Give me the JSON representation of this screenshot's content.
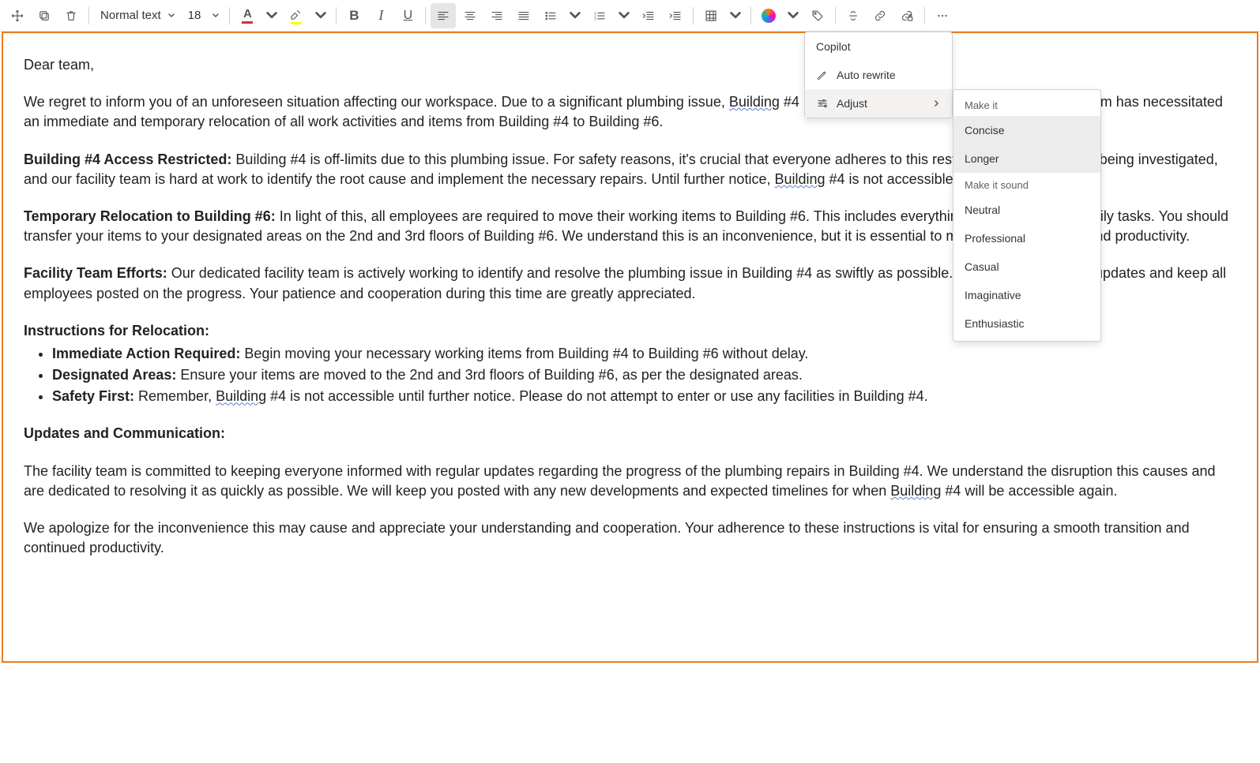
{
  "toolbar": {
    "style_label": "Normal text",
    "font_size": "18"
  },
  "copilot_menu": {
    "copilot": "Copilot",
    "auto_rewrite": "Auto rewrite",
    "adjust": "Adjust"
  },
  "adjust_menu": {
    "header1": "Make it",
    "concise": "Concise",
    "longer": "Longer",
    "header2": "Make it sound",
    "neutral": "Neutral",
    "professional": "Professional",
    "casual": "Casual",
    "imaginative": "Imaginative",
    "enthusiastic": "Enthusiastic"
  },
  "doc": {
    "greeting": "Dear team,",
    "p1a": "We regret to inform you of an unforeseen situation affecting our workspace. Due to a significant plumbing issue, ",
    "p1_link1": "Building",
    "p1b": " #4 is no longer accessible. This unforeseen problem has necessitated an immediate and temporary relocation of all work activities and items from Building #4 to Building #6.",
    "p2_h": "Building #4 Access Restricted:",
    "p2a": " Building #4 is off-limits due to this plumbing issue. For safety reasons, it's crucial that everyone adheres to this restriction. The problem is being investigated, and our facility team is hard at work to identify the root cause and implement the necessary repairs. Until further notice, ",
    "p2_link": "Building",
    "p2b": " #4 is not accessible to any employees.",
    "p3_h": "Temporary Relocation to Building #6:",
    "p3a": " In light of this, all employees are required to move their working items to Building #6. This includes everything you need for your daily tasks. You should transfer your items to your designated areas on the 2nd and 3rd floors of Building #6. We understand this is an inconvenience, but it is essential to maintain our workflow and productivity.",
    "p4_h": "Facility Team Efforts:",
    "p4a": " Our dedicated facility team is actively working to identify and resolve the plumbing issue in Building #4 as swiftly as possible. The team will provide updates and keep all employees posted on the progress. Your patience and cooperation during this time are greatly appreciated.",
    "p5_h": "Instructions for Relocation:",
    "li1_h": "Immediate Action Required:",
    "li1_t": " Begin moving your necessary working items from Building #4 to Building #6 without delay.",
    "li2_h": "Designated Areas:",
    "li2_t": " Ensure your items are moved to the 2nd and 3rd floors of Building #6, as per the designated areas.",
    "li3_h": "Safety First:",
    "li3_ta": " Remember, ",
    "li3_link": "Building",
    "li3_tb": " #4 is not accessible until further notice. Please do not attempt to enter or use any facilities in Building #4.",
    "p6_h": "Updates and Communication:",
    "p7a": "The facility team is committed to keeping everyone informed with regular updates regarding the progress of the plumbing repairs in Building #4. We understand the disruption this causes and are dedicated to resolving it as quickly as possible. We will keep you posted with any new developments and expected timelines for when ",
    "p7_link": "Building",
    "p7b": " #4 will be accessible again.",
    "p8": "We apologize for the inconvenience this may cause and appreciate your understanding and cooperation. Your adherence to these instructions is vital for ensuring a smooth transition and continued productivity."
  }
}
